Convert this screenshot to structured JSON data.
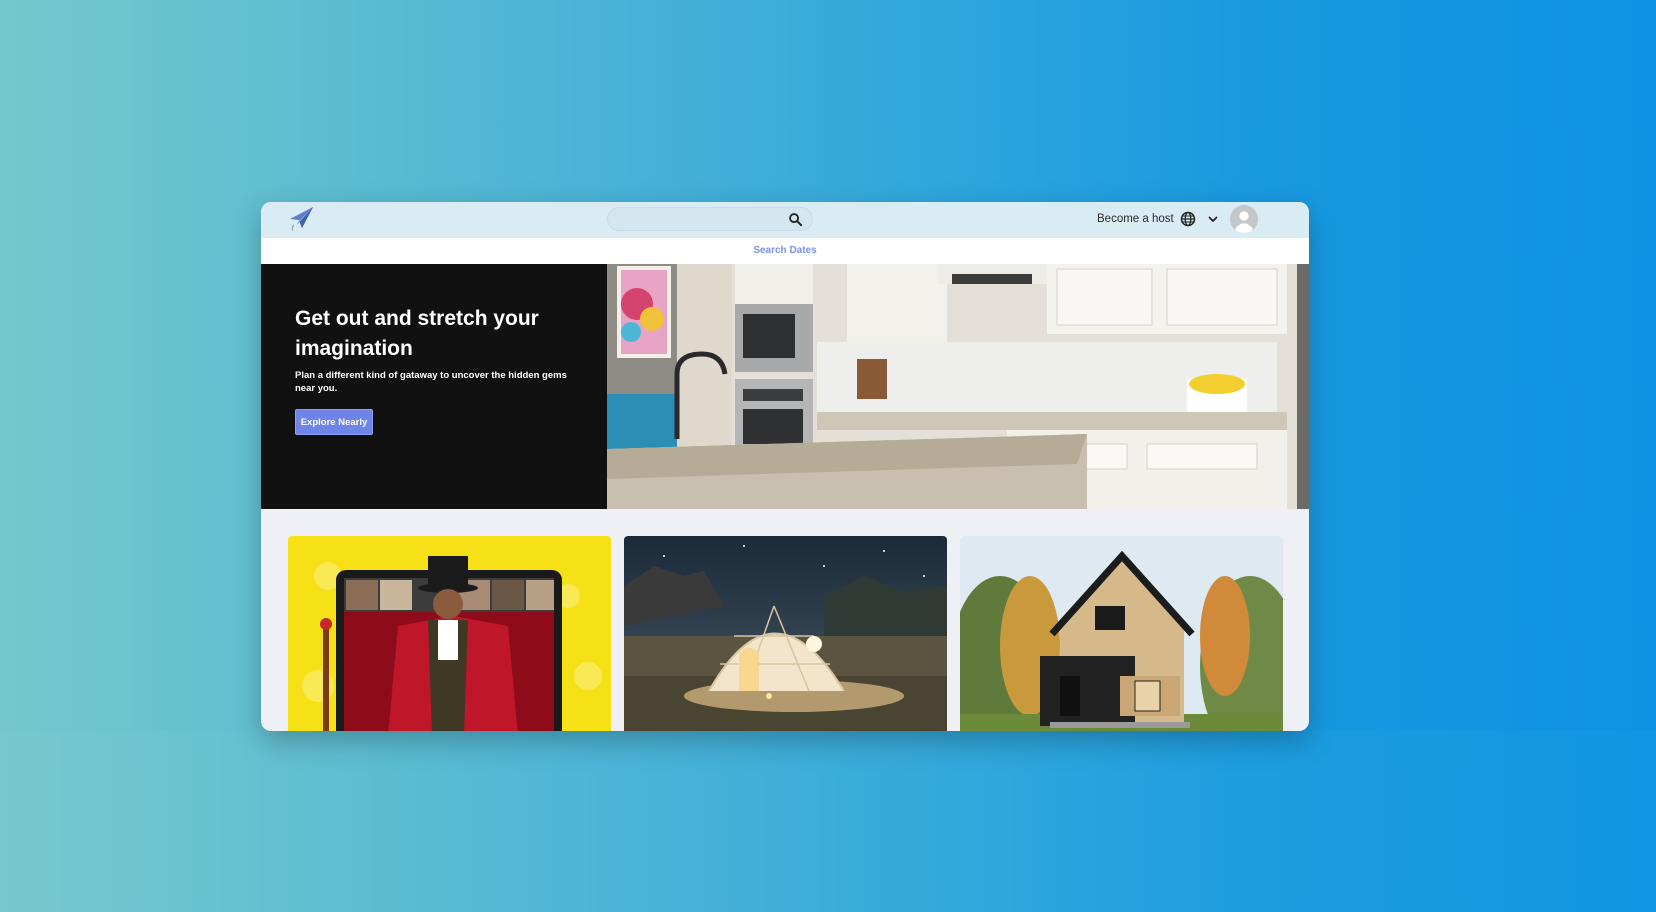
{
  "navbar": {
    "logo_icon": "paper-plane-icon",
    "search_placeholder": "",
    "search_icon": "search-icon",
    "become_host_label": "Become a host",
    "globe_icon": "globe-icon",
    "chevron_icon": "chevron-down-icon",
    "avatar_icon": "user-avatar-icon"
  },
  "date_bar": {
    "search_dates_label": "Search Dates"
  },
  "hero": {
    "title": "Get out and stretch your imagination",
    "subtitle": "Plan a different kind of gataway to uncover the hidden gems near you.",
    "button_label": "Explore Nearly",
    "image": "kitchen-photo"
  },
  "cards": [
    {
      "image": "online-experience-ringmaster-photo"
    },
    {
      "image": "dome-tent-night-photo"
    },
    {
      "image": "a-frame-cabin-photo"
    }
  ],
  "colors": {
    "accent": "#6f84e8",
    "accent_text": "#7b90e9",
    "hero_panel": "#111111",
    "topbar": "#d9ebf3"
  }
}
